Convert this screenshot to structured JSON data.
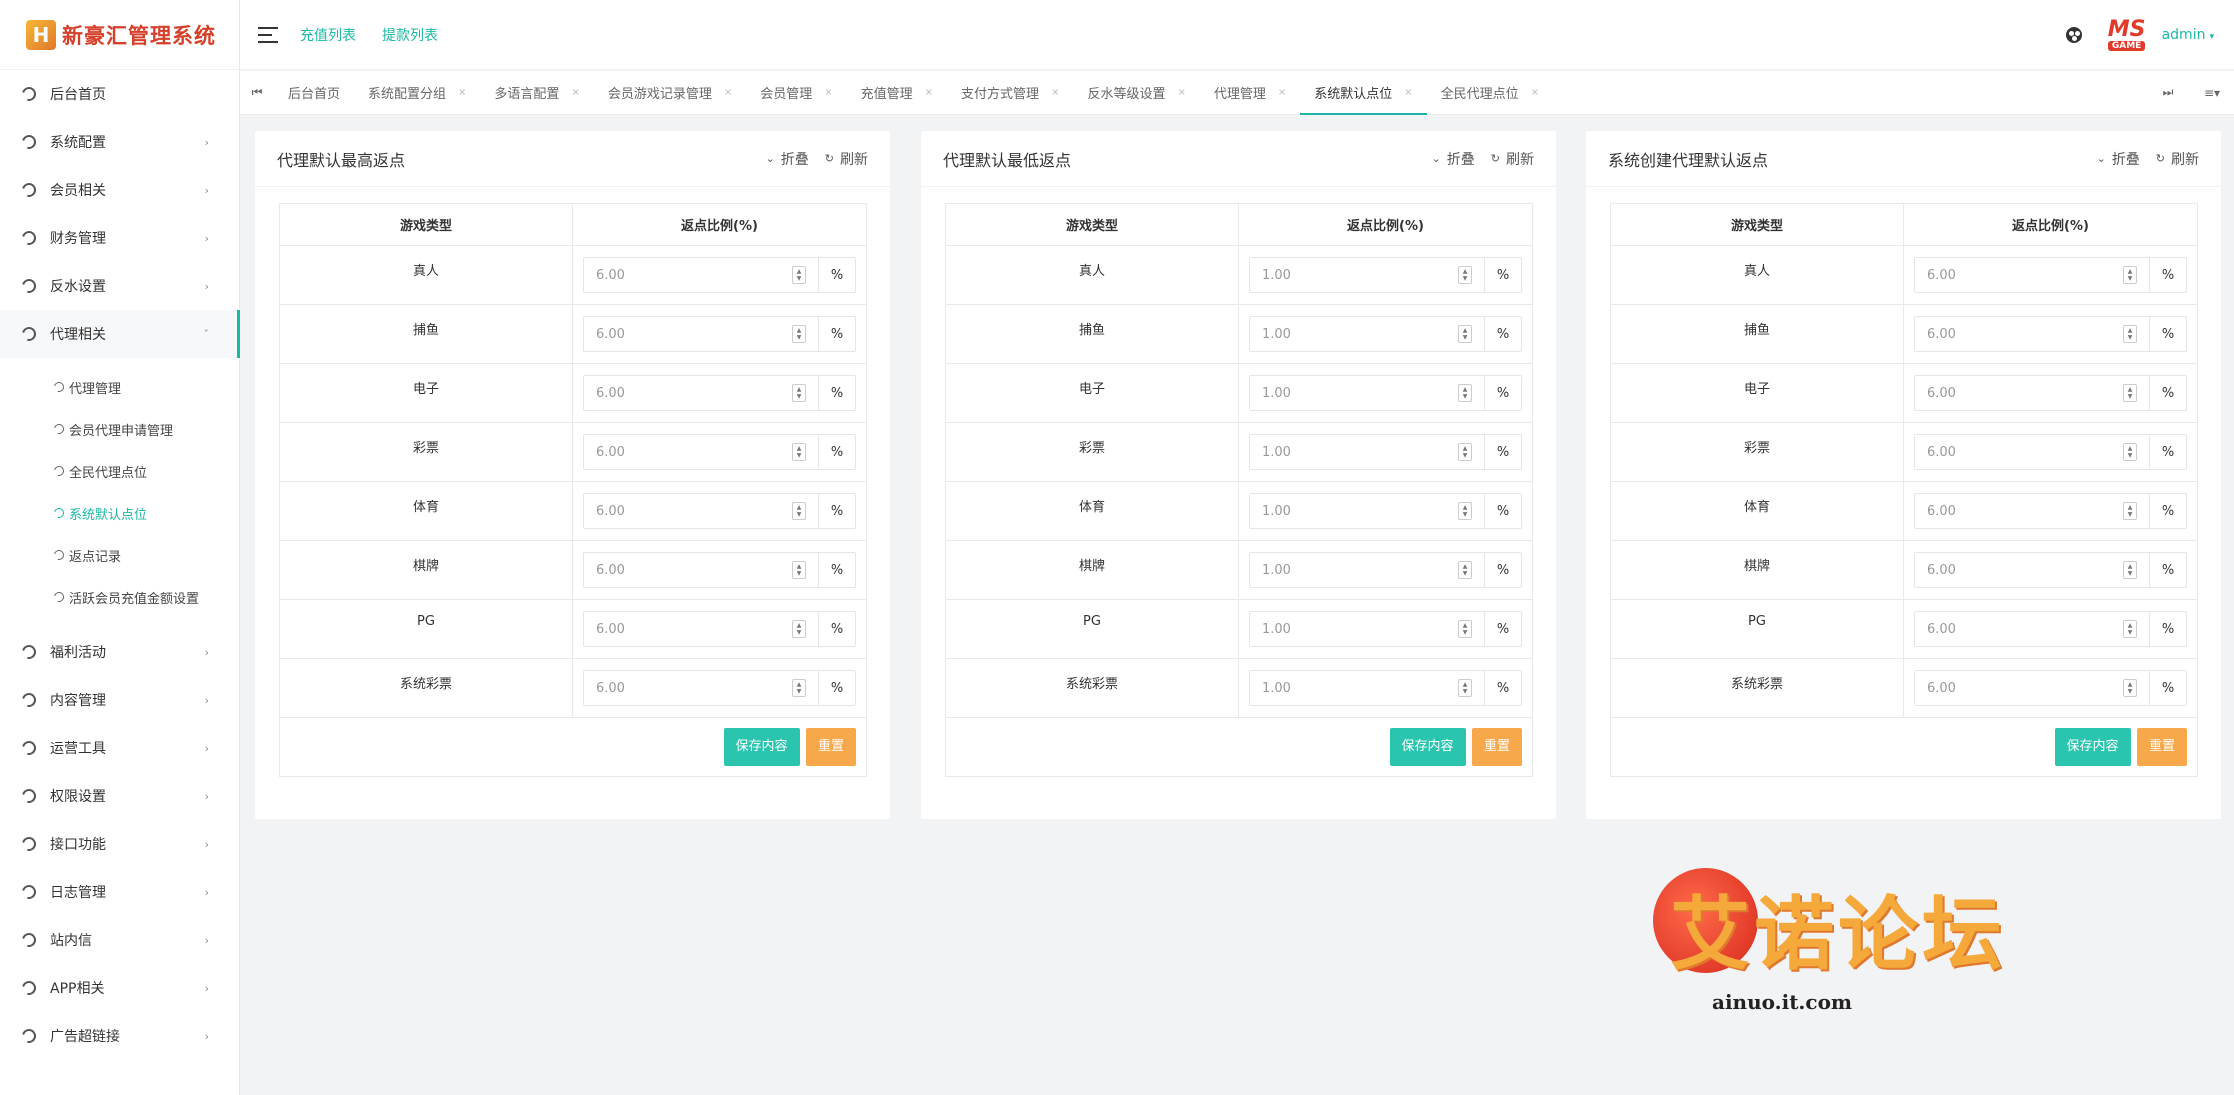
{
  "app": {
    "logo_mark": "H",
    "logo_text": "新豪汇管理系统"
  },
  "sidebar": {
    "items": [
      {
        "label": "后台首页",
        "arrow": ""
      },
      {
        "label": "系统配置",
        "arrow": "›"
      },
      {
        "label": "会员相关",
        "arrow": "›"
      },
      {
        "label": "财务管理",
        "arrow": "›"
      },
      {
        "label": "反水设置",
        "arrow": "›"
      },
      {
        "label": "代理相关",
        "arrow": "ˇ"
      }
    ],
    "sub_items": [
      {
        "label": "代理管理"
      },
      {
        "label": "会员代理申请管理"
      },
      {
        "label": "全民代理点位"
      },
      {
        "label": "系统默认点位"
      },
      {
        "label": "返点记录"
      },
      {
        "label": "活跃会员充值金额设置"
      }
    ],
    "items_after": [
      {
        "label": "福利活动",
        "arrow": "›"
      },
      {
        "label": "内容管理",
        "arrow": "›"
      },
      {
        "label": "运营工具",
        "arrow": "›"
      },
      {
        "label": "权限设置",
        "arrow": "›"
      },
      {
        "label": "接口功能",
        "arrow": "›"
      },
      {
        "label": "日志管理",
        "arrow": "›"
      },
      {
        "label": "站内信",
        "arrow": "›"
      },
      {
        "label": "APP相关",
        "arrow": "›"
      },
      {
        "label": "广告超链接",
        "arrow": "›"
      }
    ]
  },
  "header": {
    "link1": "充值列表",
    "link2": "提款列表",
    "avatar_ms": "MS",
    "avatar_game": "GAME",
    "user": "admin",
    "caret": "▾"
  },
  "tabs": {
    "prev": "⏮",
    "next": "⏭",
    "menu": "≡▾",
    "items": [
      {
        "label": "后台首页",
        "close": ""
      },
      {
        "label": "系统配置分组",
        "close": "×"
      },
      {
        "label": "多语言配置",
        "close": "×"
      },
      {
        "label": "会员游戏记录管理",
        "close": "×"
      },
      {
        "label": "会员管理",
        "close": "×"
      },
      {
        "label": "充值管理",
        "close": "×"
      },
      {
        "label": "支付方式管理",
        "close": "×"
      },
      {
        "label": "反水等级设置",
        "close": "×"
      },
      {
        "label": "代理管理",
        "close": "×"
      },
      {
        "label": "系统默认点位",
        "close": "×"
      },
      {
        "label": "全民代理点位",
        "close": "×"
      }
    ]
  },
  "panel_common": {
    "collapse": "折叠",
    "refresh": "刷新",
    "col_game": "游戏类型",
    "col_ratio": "返点比例(%)",
    "unit": "%",
    "save": "保存内容",
    "reset": "重置"
  },
  "panels": [
    {
      "title": "代理默认最高返点",
      "rows": [
        {
          "game": "真人",
          "value": "6.00"
        },
        {
          "game": "捕鱼",
          "value": "6.00"
        },
        {
          "game": "电子",
          "value": "6.00"
        },
        {
          "game": "彩票",
          "value": "6.00"
        },
        {
          "game": "体育",
          "value": "6.00"
        },
        {
          "game": "棋牌",
          "value": "6.00"
        },
        {
          "game": "PG",
          "value": "6.00"
        },
        {
          "game": "系统彩票",
          "value": "6.00"
        }
      ]
    },
    {
      "title": "代理默认最低返点",
      "rows": [
        {
          "game": "真人",
          "value": "1.00"
        },
        {
          "game": "捕鱼",
          "value": "1.00"
        },
        {
          "game": "电子",
          "value": "1.00"
        },
        {
          "game": "彩票",
          "value": "1.00"
        },
        {
          "game": "体育",
          "value": "1.00"
        },
        {
          "game": "棋牌",
          "value": "1.00"
        },
        {
          "game": "PG",
          "value": "1.00"
        },
        {
          "game": "系统彩票",
          "value": "1.00"
        }
      ]
    },
    {
      "title": "系统创建代理默认返点",
      "rows": [
        {
          "game": "真人",
          "value": "6.00"
        },
        {
          "game": "捕鱼",
          "value": "6.00"
        },
        {
          "game": "电子",
          "value": "6.00"
        },
        {
          "game": "彩票",
          "value": "6.00"
        },
        {
          "game": "体育",
          "value": "6.00"
        },
        {
          "game": "棋牌",
          "value": "6.00"
        },
        {
          "game": "PG",
          "value": "6.00"
        },
        {
          "game": "系统彩票",
          "value": "6.00"
        }
      ]
    }
  ],
  "watermark": {
    "text": "艾诺论坛",
    "url": "ainuo.it.com"
  },
  "colors": {
    "accent": "#1bb8a6",
    "save": "#2bc4ae",
    "reset": "#f6a84a"
  }
}
